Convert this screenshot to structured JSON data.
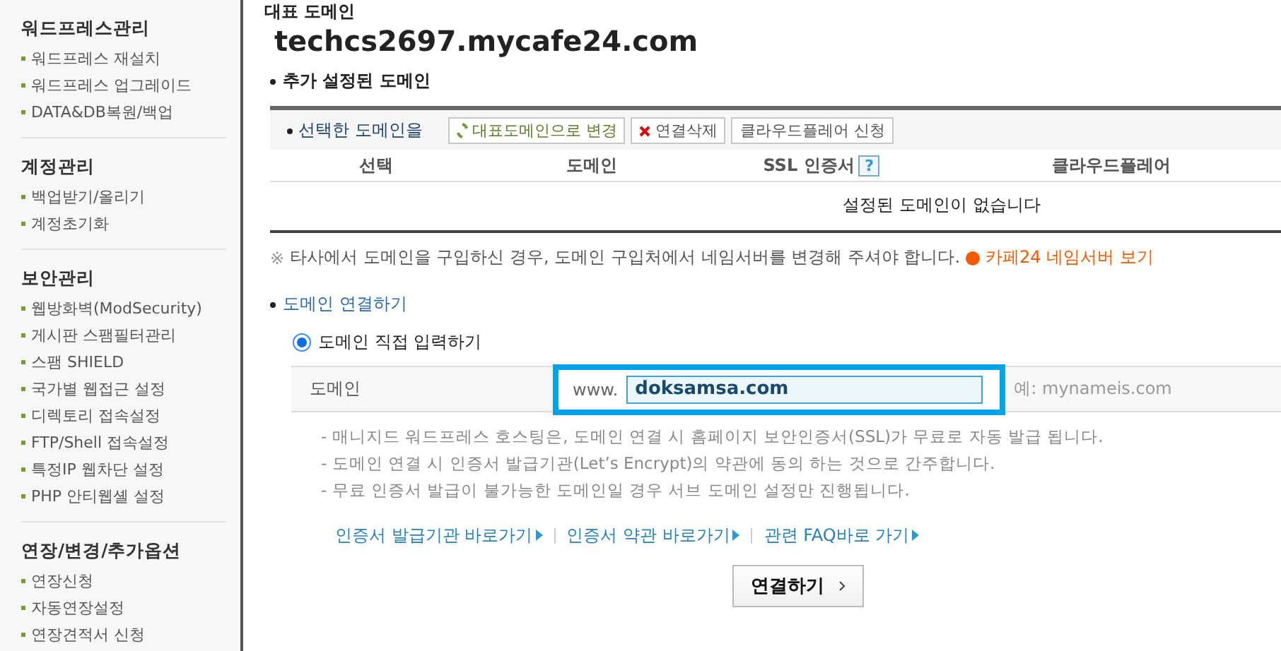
{
  "sidebar": {
    "sections": [
      {
        "title": "워드프레스관리",
        "items": [
          "워드프레스 재설치",
          "워드프레스 업그레이드",
          "DATA&DB복원/백업"
        ]
      },
      {
        "title": "계정관리",
        "items": [
          "백업받기/올리기",
          "계정초기화"
        ]
      },
      {
        "title": "보안관리",
        "items": [
          "웹방화벽(ModSecurity)",
          "게시판 스팸필터관리",
          "스팸 SHIELD",
          "국가별 웹접근 설정",
          "디렉토리 접속설정",
          "FTP/Shell 접속설정",
          "특정IP 웹차단 설정",
          "PHP 안티웹셸 설정"
        ]
      },
      {
        "title": "연장/변경/추가옵션",
        "items": [
          "연장신청",
          "자동연장설정",
          "연장견적서 신청"
        ]
      }
    ]
  },
  "main_domain": {
    "heading": "대표 도메인",
    "value": "techcs2697.mycafe24.com"
  },
  "extra_domains": {
    "heading": "추가 설정된 도메인",
    "action_label": "선택한 도메인을",
    "actions": [
      {
        "kind": "refresh",
        "label": "대표도메인으로 변경"
      },
      {
        "kind": "delete",
        "label": "연결삭제"
      },
      {
        "kind": "plain",
        "label": "클라우드플레어 신청"
      }
    ],
    "columns": [
      "선택",
      "도메인",
      "SSL 인증서",
      "클라우드플레어"
    ],
    "help": "?",
    "empty": "설정된 도메인이 없습니다"
  },
  "notice": {
    "mark": "※",
    "text": "타사에서 도메인을 구입하신 경우, 도메인 구입처에서 네임서버를 변경해 주셔야 합니다.",
    "link": "카페24 네임서버 보기"
  },
  "connect": {
    "heading": "도메인 연결하기",
    "radio": {
      "label": "도메인 직접 입력하기",
      "selected": true
    },
    "field_label": "도메인",
    "prefix": "www.",
    "value": "doksamsa.com",
    "hint": "예: mynameis.com",
    "notes": [
      "- 매니지드 워드프레스 호스팅은, 도메인 연결 시 홈페이지 보안인증서(SSL)가 무료로 자동 발급 됩니다.",
      "- 도메인 연결 시 인증서 발급기관(Let’s Encrypt)의 약관에 동의 하는 것으로 간주합니다.",
      "- 무료 인증서 발급이 불가능한 도메인일 경우 서브 도메인 설정만 진행됩니다."
    ],
    "links": [
      "인증서 발급기관 바로가기",
      "인증서 약관 바로가기",
      "관련 FAQ바로 가기"
    ],
    "submit": "연결하기"
  }
}
